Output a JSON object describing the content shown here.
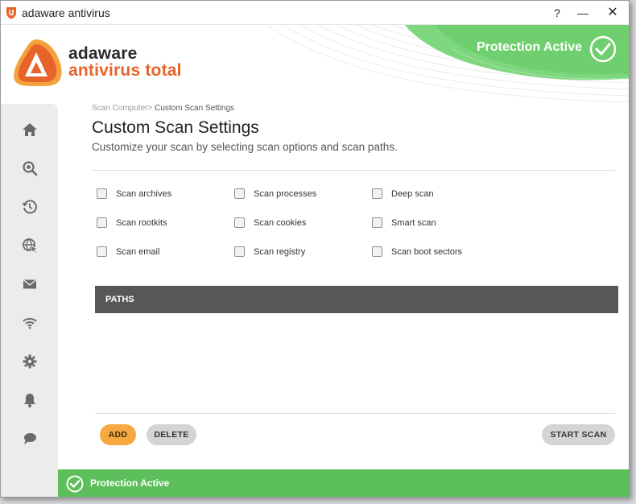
{
  "window": {
    "title": "adaware antivirus",
    "help_glyph": "?",
    "minimize_glyph": "—",
    "close_glyph": "✕"
  },
  "header": {
    "brand_name": "adaware",
    "brand_product": "antivirus total",
    "protection_status": "Protection Active",
    "accent_green": "#5cbf5c",
    "brand_orange": "#e8632a"
  },
  "sidebar": {
    "items": [
      {
        "name": "home",
        "icon": "home-icon"
      },
      {
        "name": "scan",
        "icon": "scan-magnifier-icon"
      },
      {
        "name": "history",
        "icon": "history-clock-icon"
      },
      {
        "name": "web",
        "icon": "globe-cursor-icon"
      },
      {
        "name": "email",
        "icon": "envelope-icon"
      },
      {
        "name": "network",
        "icon": "wifi-icon"
      },
      {
        "name": "settings",
        "icon": "gear-icon"
      },
      {
        "name": "notifications",
        "icon": "bell-icon"
      },
      {
        "name": "feedback",
        "icon": "chat-bubble-icon"
      }
    ]
  },
  "main": {
    "breadcrumb_parent": "Scan Computer>",
    "breadcrumb_current": "Custom Scan Settings",
    "title": "Custom Scan Settings",
    "subtitle": "Customize your scan by selecting scan options and scan paths.",
    "options": [
      {
        "label": "Scan archives",
        "checked": false
      },
      {
        "label": "Scan processes",
        "checked": false
      },
      {
        "label": "Deep scan",
        "checked": false
      },
      {
        "label": "Scan rootkits",
        "checked": false
      },
      {
        "label": "Scan cookies",
        "checked": false
      },
      {
        "label": "Smart scan",
        "checked": false
      },
      {
        "label": "Scan email",
        "checked": false
      },
      {
        "label": "Scan registry",
        "checked": false
      },
      {
        "label": "Scan boot sectors",
        "checked": false
      }
    ],
    "paths_header": "PATHS",
    "add_label": "ADD",
    "delete_label": "DELETE",
    "start_scan_label": "START SCAN"
  },
  "statusbar": {
    "label": "Protection Active"
  }
}
